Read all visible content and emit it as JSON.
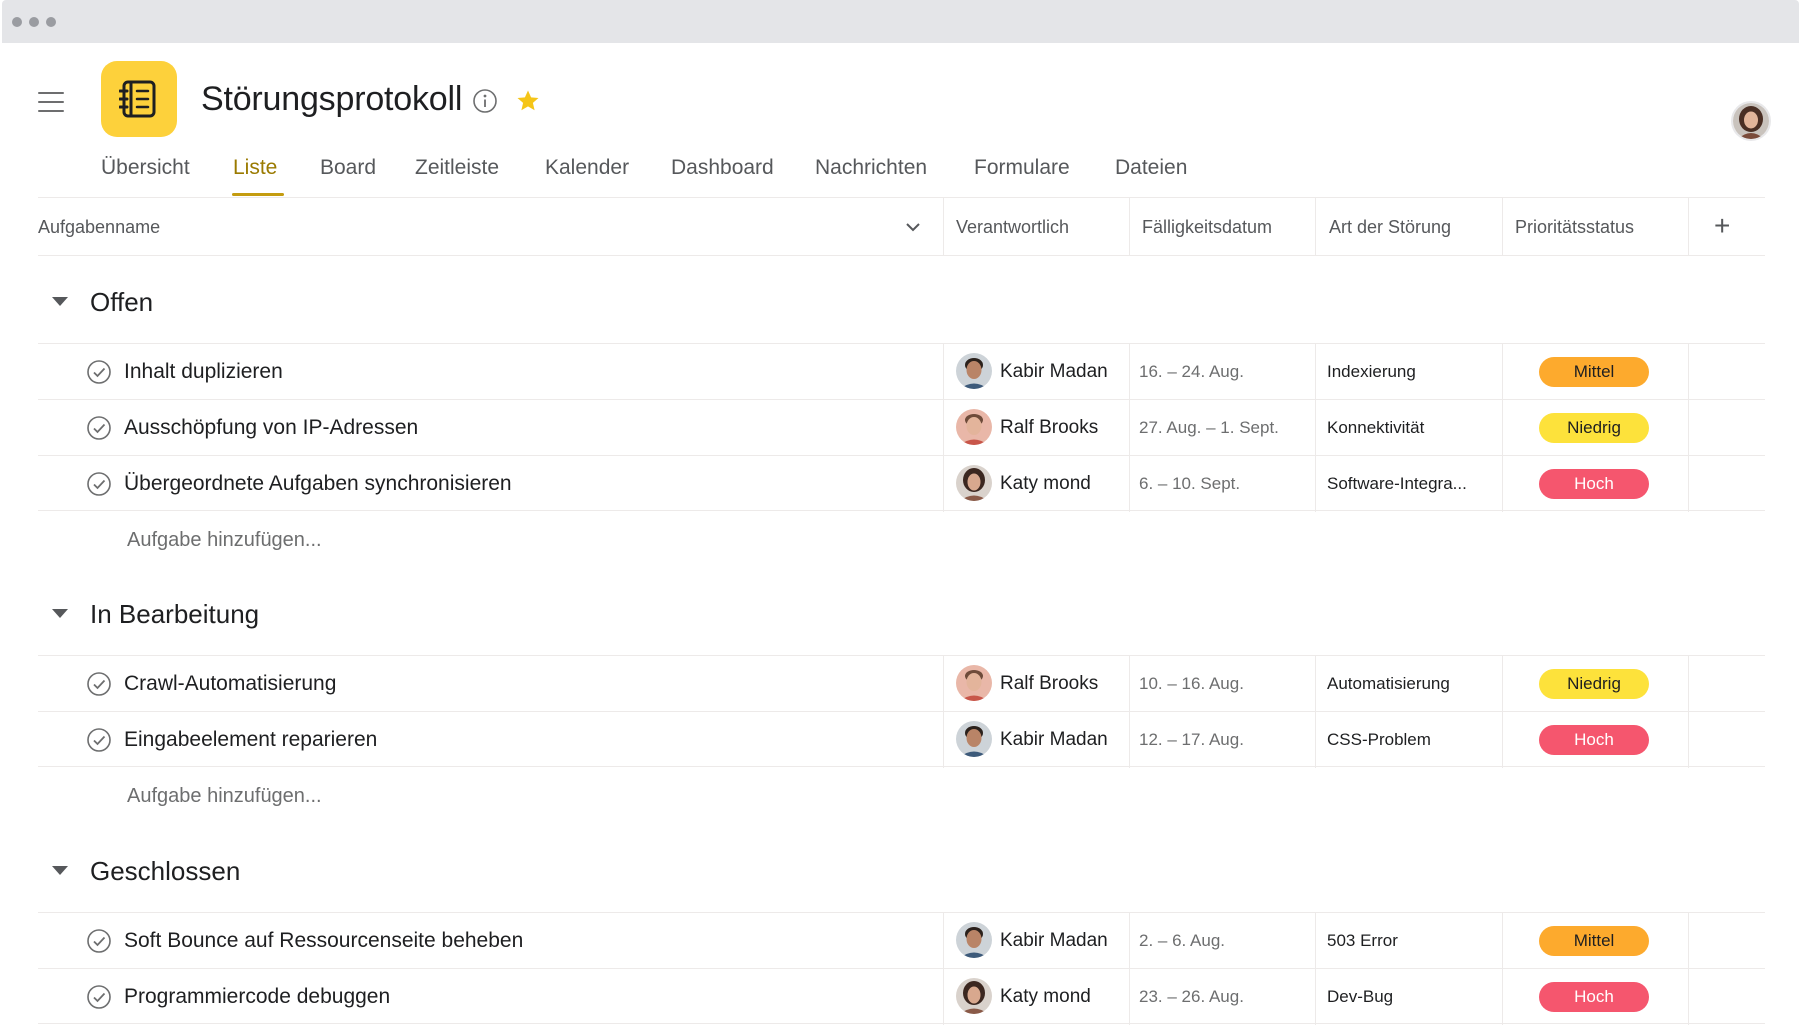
{
  "project": {
    "title": "Störungsprotokoll"
  },
  "tabs": [
    "Übersicht",
    "Liste",
    "Board",
    "Zeitleiste",
    "Kalender",
    "Dashboard",
    "Nachrichten",
    "Formulare",
    "Dateien"
  ],
  "active_tab": "Liste",
  "columns": {
    "task_name": "Aufgabenname",
    "assignee": "Verantwortlich",
    "due_date": "Fälligkeitsdatum",
    "kind": "Art der Störung",
    "priority": "Prioritätsstatus",
    "add": "+"
  },
  "add_task_label": "Aufgabe hinzufügen...",
  "priority_colors": {
    "Mittel": {
      "bg": "#fdaa2d",
      "fg": "#1e1f21"
    },
    "Niedrig": {
      "bg": "#fde23b",
      "fg": "#1e1f21"
    },
    "Hoch": {
      "bg": "#f5566e",
      "fg": "#ffffff"
    }
  },
  "sections": [
    {
      "title": "Offen",
      "tasks": [
        {
          "name": "Inhalt duplizieren",
          "assignee": "Kabir Madan",
          "due": "16. – 24. Aug.",
          "kind": "Indexierung",
          "priority": "Mittel"
        },
        {
          "name": "Ausschöpfung von IP-Adressen",
          "assignee": "Ralf Brooks",
          "due": "27. Aug. – 1. Sept.",
          "kind": "Konnektivität",
          "priority": "Niedrig"
        },
        {
          "name": "Übergeordnete Aufgaben synchronisieren",
          "assignee": "Katy mond",
          "due": "6. – 10. Sept.",
          "kind": "Software-Integra...",
          "priority": "Hoch"
        }
      ]
    },
    {
      "title": "In Bearbeitung",
      "tasks": [
        {
          "name": "Crawl-Automatisierung",
          "assignee": "Ralf Brooks",
          "due": "10. – 16. Aug.",
          "kind": "Automatisierung",
          "priority": "Niedrig"
        },
        {
          "name": "Eingabeelement reparieren",
          "assignee": "Kabir Madan",
          "due": "12. – 17. Aug.",
          "kind": "CSS-Problem",
          "priority": "Hoch"
        }
      ]
    },
    {
      "title": "Geschlossen",
      "tasks": [
        {
          "name": "Soft Bounce auf Ressourcenseite beheben",
          "assignee": "Kabir Madan",
          "due": "2. – 6. Aug.",
          "kind": "503 Error",
          "priority": "Mittel"
        },
        {
          "name": "Programmiercode debuggen",
          "assignee": "Katy mond",
          "due": "23. – 26. Aug.",
          "kind": "Dev-Bug",
          "priority": "Hoch"
        }
      ]
    }
  ]
}
